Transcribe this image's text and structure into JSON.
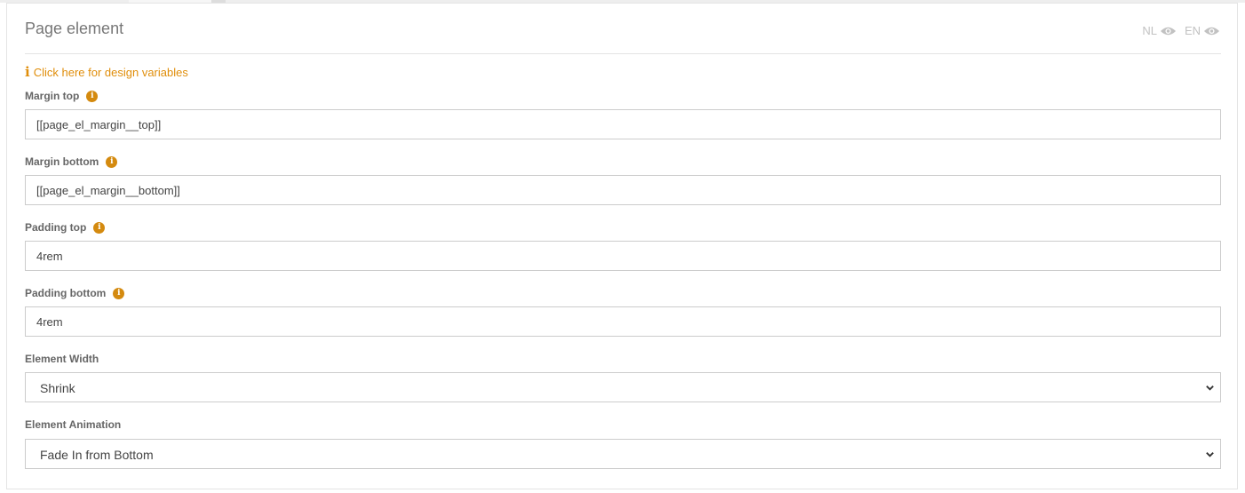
{
  "panel": {
    "title": "Page element",
    "languages": [
      {
        "code": "NL",
        "icon": "eye-icon"
      },
      {
        "code": "EN",
        "icon": "eye-icon"
      }
    ],
    "design_variables_link": "Click here for design variables"
  },
  "fields": {
    "margin_top": {
      "label": "Margin top",
      "value": "[[page_el_margin__top]]"
    },
    "margin_bottom": {
      "label": "Margin bottom",
      "value": "[[page_el_margin__bottom]]"
    },
    "padding_top": {
      "label": "Padding top",
      "value": "4rem"
    },
    "padding_bottom": {
      "label": "Padding bottom",
      "value": "4rem"
    },
    "element_width": {
      "label": "Element Width",
      "selected": "Shrink"
    },
    "element_animation": {
      "label": "Element Animation",
      "selected": "Fade In from Bottom"
    }
  },
  "colors": {
    "accent": "#e08e0b",
    "border": "#cccccc",
    "muted": "#c2c2c2"
  }
}
